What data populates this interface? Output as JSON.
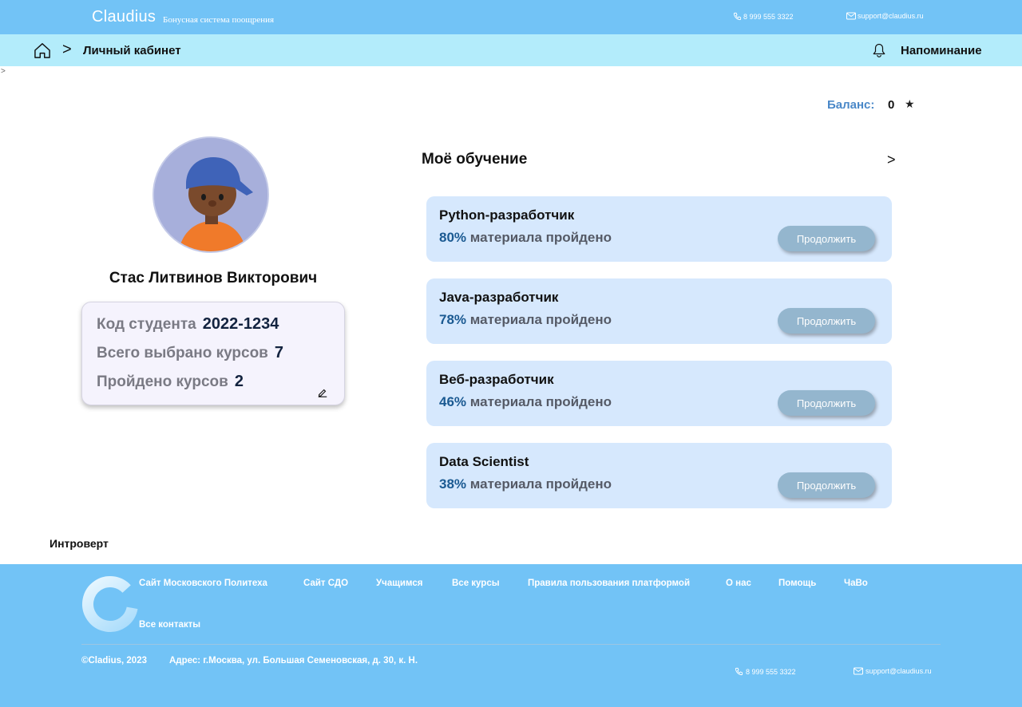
{
  "header": {
    "brand": "Claudius",
    "brand_subtitle": "Бонусная система поощрения",
    "phone": "8 999 555 3322",
    "email": "support@claudius.ru"
  },
  "breadcrumb": {
    "separator": ">",
    "current": "Личный кабинет",
    "reminder_label": "Напоминание",
    "stray_mark": ">"
  },
  "balance": {
    "label": "Баланс:",
    "value": "0",
    "icon": "star-icon"
  },
  "profile": {
    "name": "Стас Литвинов Викторович",
    "stats": [
      {
        "label": "Код студента",
        "value": "2022-1234"
      },
      {
        "label": "Всего выбрано курсов",
        "value": "7"
      },
      {
        "label": "Пройдено курсов",
        "value": "2"
      }
    ]
  },
  "learning": {
    "title": "Моё обучение",
    "more": ">",
    "progress_suffix": "материала пройдено",
    "button_label": "Продолжить",
    "courses": [
      {
        "name": "Python-разработчик",
        "percent": "80%"
      },
      {
        "name": "Java-разработчик",
        "percent": "78%"
      },
      {
        "name": "Веб-разработчик",
        "percent": "46%"
      },
      {
        "name": "Data Scientist",
        "percent": "38%"
      }
    ]
  },
  "status": {
    "label": "Интроверт"
  },
  "footer": {
    "links": [
      "Сайт Московского Политеха",
      "Сайт СДО",
      "Учащимся",
      "Все курсы",
      "Правила пользования платформой",
      "О нас",
      "Помощь",
      "ЧаВо",
      "Все контакты"
    ],
    "copyright": "©Cladius, 2023",
    "address": "Адрес: г.Москва, ул. Большая Семеновская, д. 30, к. Н.",
    "phone": "8 999 555 3322",
    "email": "support@claudius.ru"
  },
  "colors": {
    "header_bg": "#72c3f6",
    "breadcrumb_bg": "#b3ecfb",
    "card_bg": "#d6e8fd",
    "button_bg": "#94b6ce",
    "percent": "#1b5a92",
    "balance_label": "#4a88c8"
  }
}
